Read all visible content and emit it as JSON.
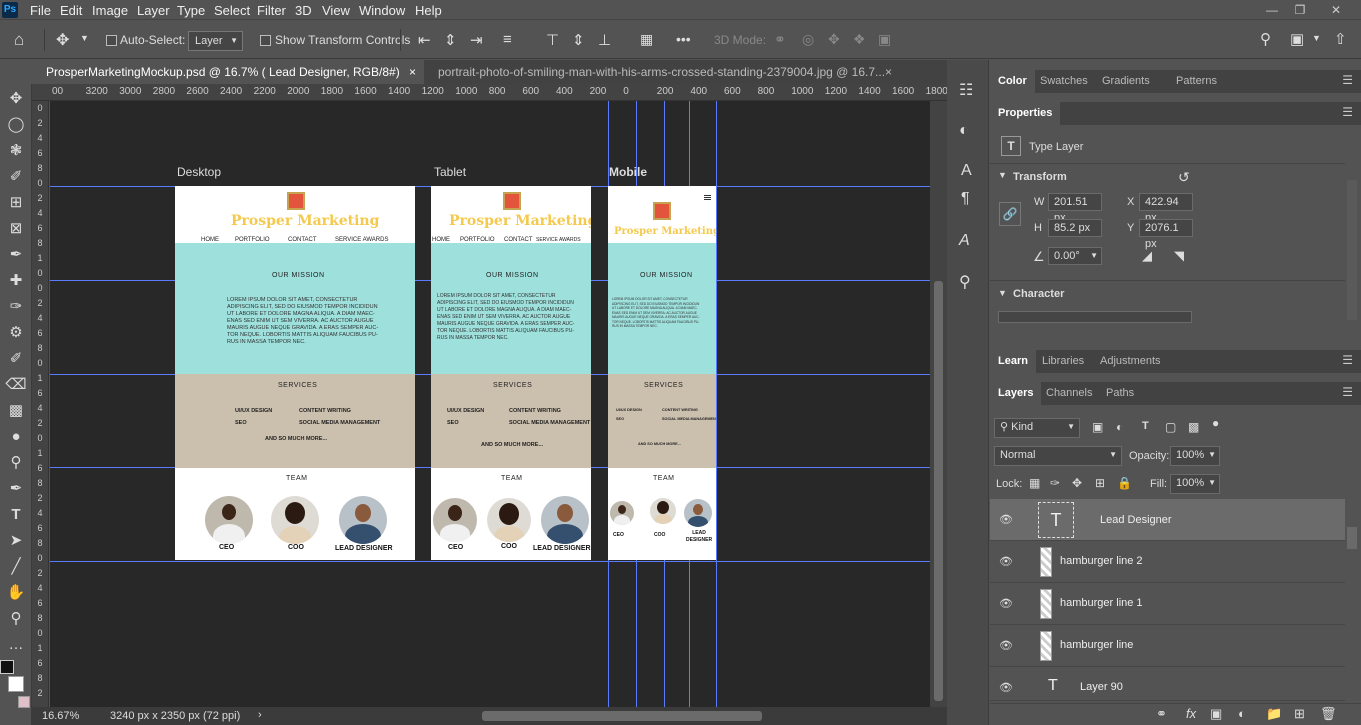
{
  "menu": {
    "app_logo": "Ps",
    "items": [
      "File",
      "Edit",
      "Image",
      "Layer",
      "Type",
      "Select",
      "Filter",
      "3D",
      "View",
      "Window",
      "Help"
    ]
  },
  "options": {
    "auto_select_label": "Auto-Select:",
    "auto_select_value": "Layer",
    "show_transform_label": "Show Transform Controls",
    "mode_3d_label": "3D Mode:",
    "more": "•••"
  },
  "tabs": [
    {
      "label": "ProsperMarketingMockup.psd @ 16.7% (   Lead  Designer, RGB/8#)",
      "close": "×"
    },
    {
      "label": "portrait-photo-of-smiling-man-with-his-arms-crossed-standing-2379004.jpg @ 16.7...",
      "close": "×"
    }
  ],
  "ruler": {
    "top_ticks": [
      "00",
      "3200",
      "3000",
      "2800",
      "2600",
      "2400",
      "2200",
      "2000",
      "1800",
      "1600",
      "1400",
      "1200",
      "1000",
      "800",
      "600",
      "400",
      "200",
      "0",
      "200",
      "400",
      "600",
      "800",
      "1000",
      "1200",
      "1400",
      "1600",
      "1800"
    ],
    "left_ticks": [
      "0",
      "2",
      "4",
      "6",
      "8",
      "0",
      "2",
      "4",
      "6",
      "8",
      "1",
      "0",
      "0",
      "2",
      "4",
      "6",
      "8",
      "0",
      "1",
      "6",
      "4",
      "2",
      "0",
      "1",
      "6",
      "8",
      "2",
      "4",
      "6",
      "8",
      "0",
      "2",
      "4",
      "6",
      "8",
      "0",
      "1",
      "6",
      "8",
      "2"
    ]
  },
  "artboards": {
    "desktop_label": "Desktop",
    "tablet_label": "Tablet",
    "mobile_label": "Mobile",
    "brand": "Prosper Marketing",
    "logo_text": "PM",
    "nav": [
      "HOME",
      "PORTFOLIO",
      "CONTACT",
      "SERVICE AWARDS"
    ],
    "mission_title": "OUR MISSION",
    "mission_text": "LOREM IPSUM DOLOR SIT AMET, CONSECTETUR\nADIPISCING ELIT, SED DO EIUSMOD TEMPOR INCIDIDUN\nUT LABORE ET DOLORE MAGNA ALIQUA. A DIAM MAEC-\nENAS SED ENIM UT SEM VIVERRA. AC AUCTOR AUGUE\nMAURIS AUGUE NEQUE GRAVIDA. A ERAS SEMPER AUC-\nTOR NEQUE. LOBORTIS MATTIS ALIQUAM FAUCIBUS PU-\nRUS IN MASSA TEMPOR NEC.",
    "services_title": "SERVICES",
    "services": [
      "UI/UX DESIGN",
      "CONTENT WRITING",
      "SEO",
      "SOCIAL MEDIA MANAGEMENT",
      "AND SO MUCH MORE..."
    ],
    "team_title": "TEAM",
    "roles": [
      "CEO",
      "COO",
      "LEAD DESIGNER"
    ],
    "roles_mobile": [
      "CEO",
      "COO",
      "LEAD\nDESIGNER"
    ]
  },
  "status": {
    "zoom": "16.67%",
    "doc_size": "3240 px x 2350 px (72 ppi)"
  },
  "panels": {
    "color_tabs": [
      "Color",
      "Swatches",
      "Gradients",
      "Patterns"
    ],
    "properties_title": "Properties",
    "type_layer": "Type Layer",
    "transform_title": "Transform",
    "w_label": "W",
    "w_value": "201.51 px",
    "x_label": "X",
    "x_value": "422.94 px",
    "h_label": "H",
    "h_value": "85.2 px",
    "y_label": "Y",
    "y_value": "2076.1 px",
    "angle_value": "0.00°",
    "character_title": "Character",
    "learn_tabs": [
      "Learn",
      "Libraries",
      "Adjustments"
    ],
    "layers_tabs": [
      "Layers",
      "Channels",
      "Paths"
    ],
    "kind_label": "Kind",
    "blend_mode": "Normal",
    "opacity_label": "Opacity:",
    "opacity_value": "100%",
    "lock_label": "Lock:",
    "fill_label": "Fill:",
    "fill_value": "100%",
    "layers": [
      "Lead  Designer",
      "hamburger line 2",
      "hamburger line 1",
      "hamburger line",
      "Layer 90"
    ]
  },
  "colors": {
    "accent_guide": "#5b7bff",
    "mission_bg": "#9de0dc",
    "brand_yellow": "#f4c94d",
    "logo_red": "#e2553c"
  }
}
